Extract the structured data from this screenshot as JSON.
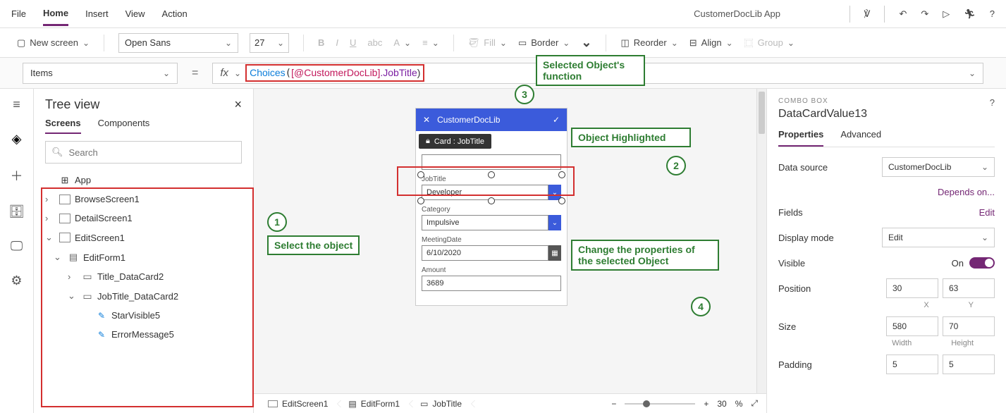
{
  "menubar": {
    "items": [
      "File",
      "Home",
      "Insert",
      "View",
      "Action"
    ],
    "app_name": "CustomerDocLib App"
  },
  "ribbon": {
    "new_screen": "New screen",
    "font": "Open Sans",
    "size": "27",
    "fill": "Fill",
    "border": "Border",
    "reorder": "Reorder",
    "align": "Align",
    "group": "Group"
  },
  "formula": {
    "property": "Items",
    "fn": "Choices",
    "ds": "[@CustomerDocLib]",
    "field": ".JobTitle",
    "suffix": ")"
  },
  "tree": {
    "title": "Tree view",
    "tab_screens": "Screens",
    "tab_components": "Components",
    "search_ph": "Search",
    "app": "App",
    "browse": "BrowseScreen1",
    "detail": "DetailScreen1",
    "edit": "EditScreen1",
    "editform": "EditForm1",
    "title_dc": "Title_DataCard2",
    "jobtitle_dc": "JobTitle_DataCard2",
    "star": "StarVisible5",
    "err": "ErrorMessage5"
  },
  "form": {
    "title": "CustomerDocLib",
    "card_badge": "Card : JobTitle",
    "fields": {
      "jobtitle_lbl": "JobTitle",
      "jobtitle_val": "Developer",
      "category_lbl": "Category",
      "category_val": "Impulsive",
      "date_lbl": "MeetingDate",
      "date_val": "6/10/2020",
      "amount_lbl": "Amount",
      "amount_val": "3689"
    }
  },
  "annotations": {
    "a1": "Select the object",
    "a2": "Object Highlighted",
    "a3": "Selected Object's function",
    "a4": "Change the properties of the selected Object"
  },
  "crumbs": {
    "c1": "EditScreen1",
    "c2": "EditForm1",
    "c3": "JobTitle",
    "zoom": "30",
    "pct": "%"
  },
  "props": {
    "type": "COMBO BOX",
    "name": "DataCardValue13",
    "tab_props": "Properties",
    "tab_adv": "Advanced",
    "data_source_lbl": "Data source",
    "data_source_val": "CustomerDocLib",
    "depends": "Depends on...",
    "fields_lbl": "Fields",
    "edit": "Edit",
    "display_lbl": "Display mode",
    "display_val": "Edit",
    "visible_lbl": "Visible",
    "on": "On",
    "position_lbl": "Position",
    "pos_x": "30",
    "pos_y": "63",
    "x": "X",
    "y": "Y",
    "size_lbl": "Size",
    "size_w": "580",
    "size_h": "70",
    "w": "Width",
    "h": "Height",
    "padding_lbl": "Padding",
    "pad_t": "5",
    "pad_b": "5"
  }
}
